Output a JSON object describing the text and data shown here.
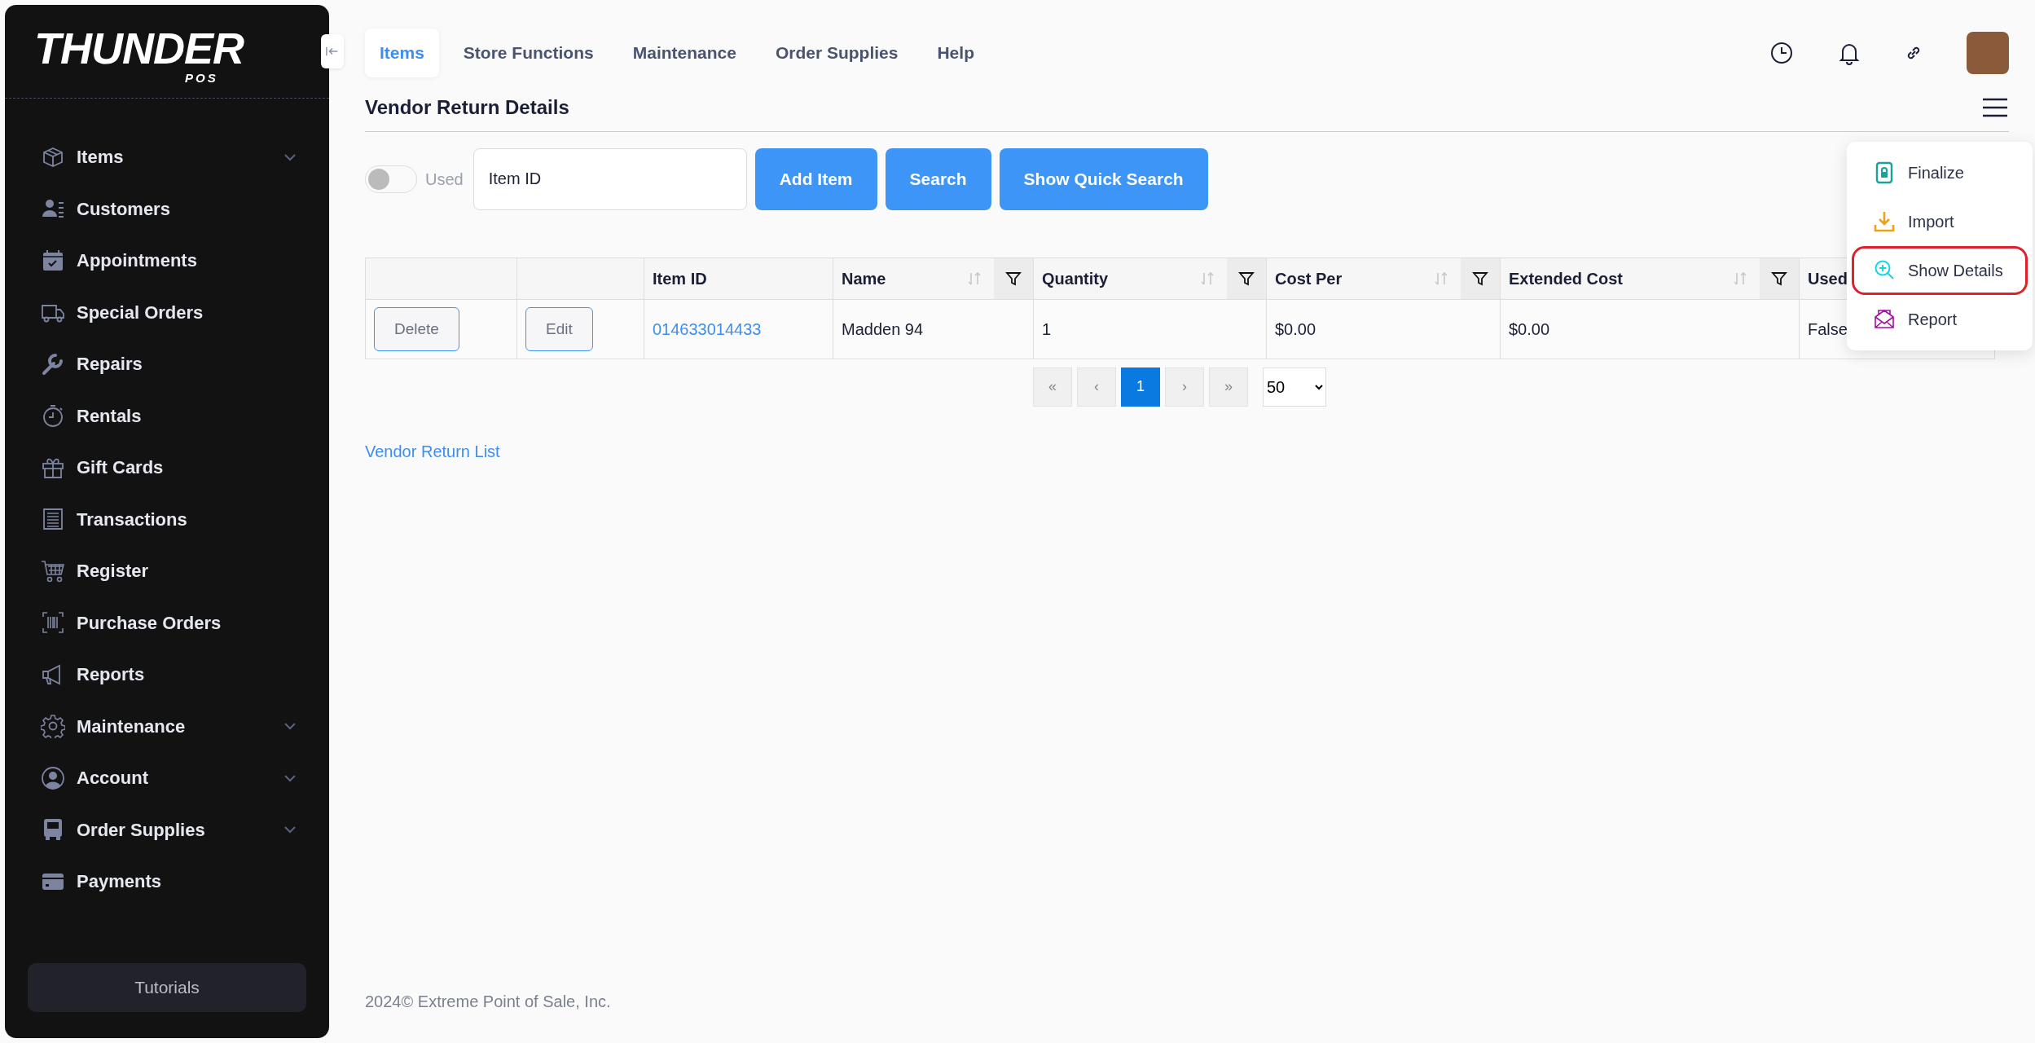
{
  "brand": {
    "name": "THUNDER",
    "sub": "POS"
  },
  "sidebar": {
    "items": [
      {
        "label": "Items",
        "kind": "box",
        "expandable": true
      },
      {
        "label": "Customers",
        "kind": "people",
        "expandable": false
      },
      {
        "label": "Appointments",
        "kind": "calendar",
        "expandable": false
      },
      {
        "label": "Special Orders",
        "kind": "truck",
        "expandable": false
      },
      {
        "label": "Repairs",
        "kind": "wrench",
        "expandable": false
      },
      {
        "label": "Rentals",
        "kind": "timer",
        "expandable": false
      },
      {
        "label": "Gift Cards",
        "kind": "gift",
        "expandable": false
      },
      {
        "label": "Transactions",
        "kind": "receipt",
        "expandable": false
      },
      {
        "label": "Register",
        "kind": "cart",
        "expandable": false
      },
      {
        "label": "Purchase Orders",
        "kind": "barcode",
        "expandable": false
      },
      {
        "label": "Reports",
        "kind": "megaphone",
        "expandable": false
      },
      {
        "label": "Maintenance",
        "kind": "gear",
        "expandable": true
      },
      {
        "label": "Account",
        "kind": "user",
        "expandable": true
      },
      {
        "label": "Order Supplies",
        "kind": "bus",
        "expandable": true
      },
      {
        "label": "Payments",
        "kind": "card",
        "expandable": false
      }
    ],
    "tutorials": "Tutorials"
  },
  "tabs": [
    {
      "label": "Items",
      "selected": true
    },
    {
      "label": "Store Functions",
      "selected": false
    },
    {
      "label": "Maintenance",
      "selected": false
    },
    {
      "label": "Order Supplies",
      "selected": false
    },
    {
      "label": "Help",
      "selected": false
    }
  ],
  "page": {
    "title": "Vendor Return Details"
  },
  "toolbar": {
    "toggle": {
      "label": "Used",
      "on": false
    },
    "item_field": {
      "placeholder": "Item ID"
    },
    "buttons": [
      "Add Item",
      "Search",
      "Show Quick Search"
    ]
  },
  "table": {
    "columns": [
      {
        "label": "Item ID",
        "sortable": false,
        "filterable": false
      },
      {
        "label": "Name",
        "sortable": true,
        "filterable": true
      },
      {
        "label": "Quantity",
        "sortable": true,
        "filterable": true
      },
      {
        "label": "Cost Per",
        "sortable": true,
        "filterable": true
      },
      {
        "label": "Extended Cost",
        "sortable": true,
        "filterable": true
      },
      {
        "label": "Used"
      }
    ],
    "rows": [
      {
        "actions": [
          "Delete",
          "Edit"
        ],
        "cells": [
          {
            "text": "014633014433",
            "kind": "link"
          },
          {
            "text": "Madden 94",
            "kind": "text"
          },
          {
            "text": "1",
            "kind": "text"
          },
          {
            "text": "$0.00",
            "kind": "text"
          },
          {
            "text": "$0.00",
            "kind": "text"
          },
          {
            "text": "False",
            "kind": "text"
          }
        ]
      }
    ]
  },
  "pagination": {
    "first": "«",
    "prev": "‹",
    "pages": [
      {
        "label": "1",
        "selected": true
      }
    ],
    "next": "›",
    "last": "»",
    "page_size": "50"
  },
  "back_link": "Vendor Return List",
  "footer": "2024© Extreme Point of Sale, Inc.",
  "menu": {
    "items": [
      {
        "label": "Finalize",
        "kind": "lock",
        "color": "#17a398",
        "highlighted": false
      },
      {
        "label": "Import",
        "kind": "download",
        "color": "#e8a317",
        "highlighted": false
      },
      {
        "label": "Show Details",
        "kind": "zoom",
        "color": "#12d6e6",
        "highlighted": true
      },
      {
        "label": "Report",
        "kind": "envelope",
        "color": "#a0129e",
        "highlighted": false
      }
    ]
  }
}
